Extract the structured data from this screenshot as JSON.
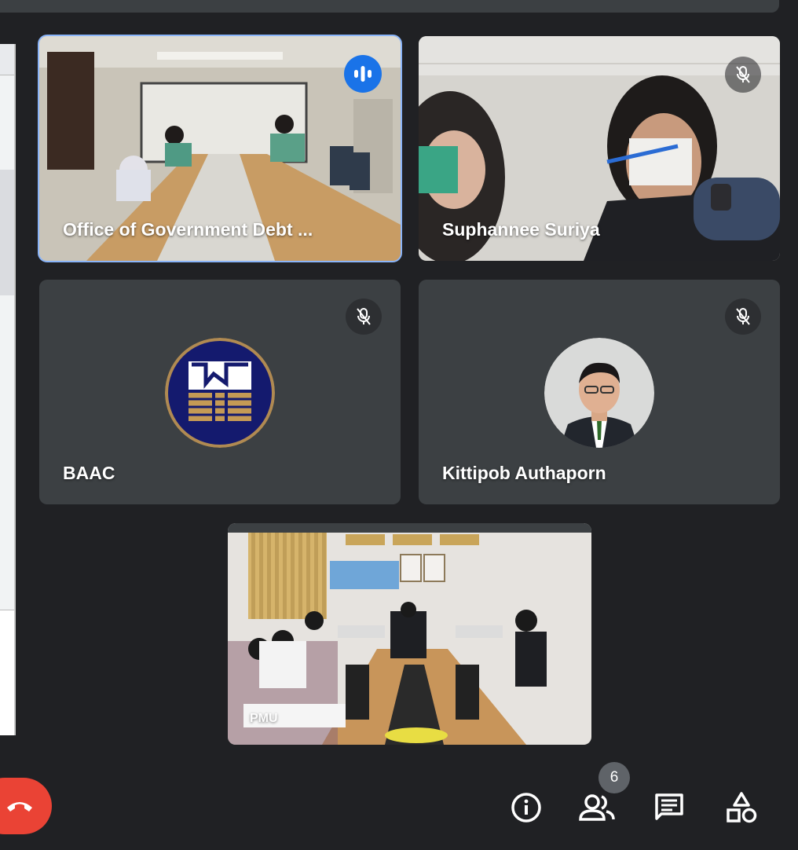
{
  "participants": [
    {
      "name": "Office of Government Debt ...",
      "status": "speaking",
      "icon": "audio-wave-icon"
    },
    {
      "name": "Suphannee Suriya",
      "status": "muted",
      "icon": "mic-off-icon"
    },
    {
      "name": "BAAC",
      "status": "muted",
      "icon": "mic-off-icon",
      "avatar": "baac-logo"
    },
    {
      "name": "Kittipob Authaporn",
      "status": "muted",
      "icon": "mic-off-icon",
      "avatar": "person-photo"
    },
    {
      "name": "PMU",
      "status": "video"
    }
  ],
  "controls": {
    "people_count": "6",
    "icons": [
      "phone-hangup-icon",
      "info-icon",
      "people-icon",
      "chat-icon",
      "activities-icon"
    ]
  },
  "colors": {
    "background": "#202124",
    "tile": "#3c4043",
    "active_outline": "#8ab4f8",
    "speaking": "#1a73e8",
    "hangup": "#ea4335"
  }
}
